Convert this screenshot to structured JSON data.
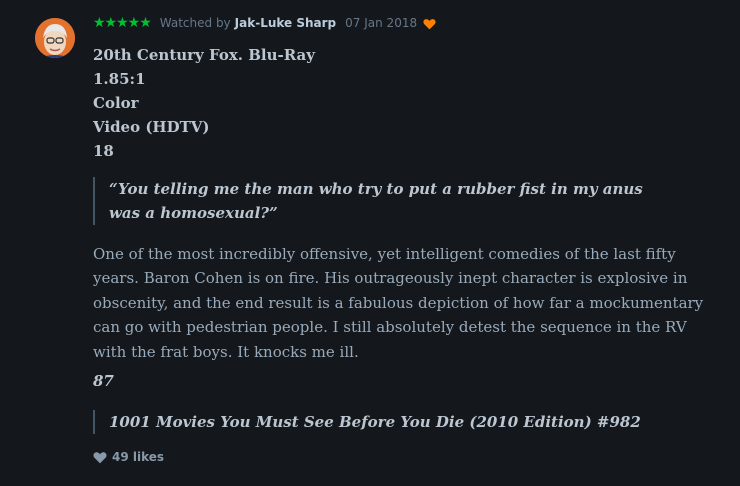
{
  "review": {
    "rating_stars": "★★★★★",
    "watched_by_label": "Watched by",
    "username": "Jak-Luke Sharp",
    "date": "07 Jan 2018",
    "liked_icon": "heart-icon",
    "specs": [
      "20th Century Fox. Blu-Ray",
      "1.85:1",
      "Color",
      "Video (HDTV)",
      "18"
    ],
    "quote": "“You telling me the man who try to put a rubber fist in my anus was a homosexual?”",
    "body": "One of the most incredibly offensive, yet intelligent comedies of the last fifty years. Baron Cohen is on fire. His outrageously inept character is explosive in obscenity, and the end result is a fabulous depiction of how far a mockumentary can go with pedestrian people. I still absolutely detest the sequence in the RV with the frat boys. It knocks me ill.",
    "score": "87",
    "list_reference": "1001 Movies You Must See Before You Die (2010 Edition) #982",
    "likes": "49 likes"
  },
  "colors": {
    "background": "#14181c",
    "stars": "#00c030",
    "heart": "#ff8000",
    "text": "#99aabb"
  }
}
